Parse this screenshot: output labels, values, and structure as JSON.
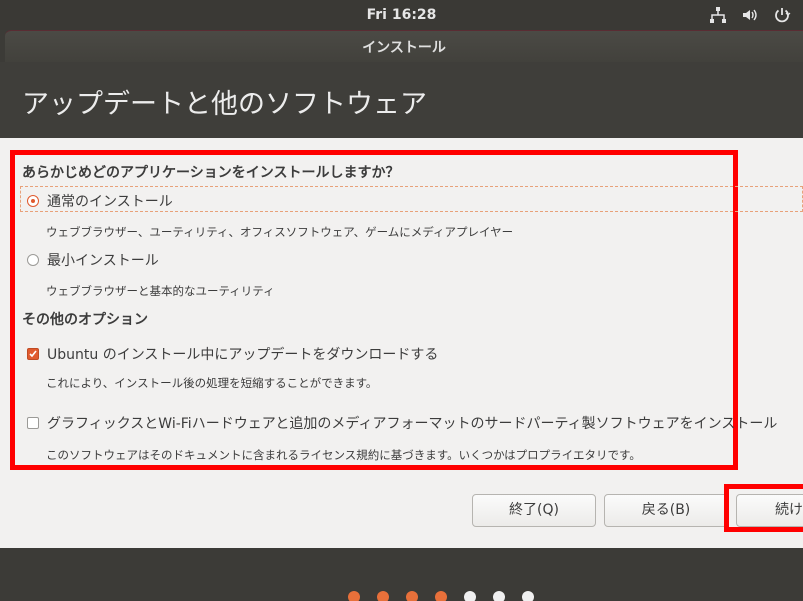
{
  "topbar": {
    "clock": "Fri 16:28",
    "tray_icons": [
      "network-icon",
      "volume-icon",
      "power-icon"
    ]
  },
  "window": {
    "title": "インストール"
  },
  "header": {
    "title": "アップデートと他のソフトウェア"
  },
  "install_question": {
    "title": "あらかじめどのアプリケーションをインストールしますか？",
    "options": [
      {
        "label": "通常のインストール",
        "description": "ウェブブラウザー、ユーティリティ、オフィスソフトウェア、ゲームにメディアプレイヤー",
        "selected": true
      },
      {
        "label": "最小インストール",
        "description": "ウェブブラウザーと基本的なユーティリティ",
        "selected": false
      }
    ]
  },
  "other_options": {
    "title": "その他のオプション",
    "items": [
      {
        "label": "Ubuntu のインストール中にアップデートをダウンロードする",
        "description": "これにより、インストール後の処理を短縮することができます。",
        "checked": true
      },
      {
        "label": "グラフィックスとWi-Fiハードウェアと追加のメディアフォーマットのサードパーティ製ソフトウェアをインストール",
        "description": "このソフトウェアはそのドキュメントに含まれるライセンス規約に基づきます。いくつかはプロプライエタリです。",
        "checked": false
      }
    ]
  },
  "buttons": {
    "quit": "終了(Q)",
    "back": "戻る(B)",
    "continue": "続け"
  },
  "progress": {
    "total_steps": 7,
    "completed_steps": 4
  },
  "colors": {
    "accent": "#e05a2e",
    "highlight_box": "#ff0000",
    "panel_bg": "#f2f1f0",
    "header_bg": "#3f3e3a"
  }
}
